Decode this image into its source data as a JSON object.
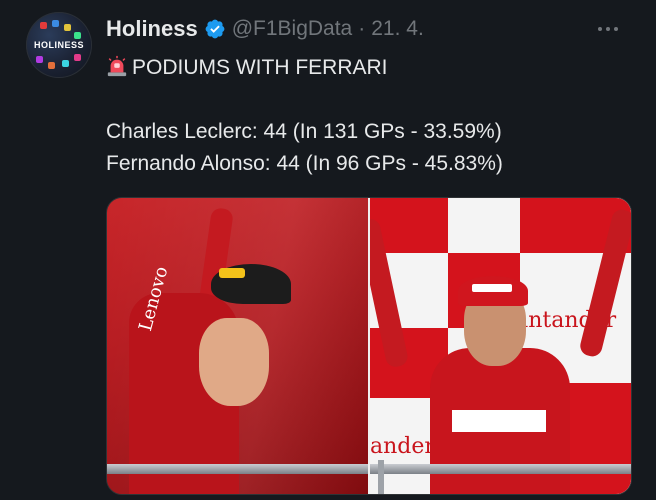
{
  "tweet": {
    "display_name": "Holiness",
    "handle": "@F1BigData",
    "separator": "·",
    "date": "21. 4.",
    "avatar_text": "HOLINESS",
    "lines": [
      "PODIUMS WITH FERRARI",
      "Charles Leclerc: 44 (In 131 GPs - 33.59%)",
      "Fernando Alonso: 44 (In 96 GPs - 45.83%)"
    ]
  },
  "media": {
    "left_sponsor_text": "Lenovo",
    "right_sponsor_text": "Santander",
    "right_bottom_text": "ander"
  },
  "icons": {
    "verified": "verified-badge-icon",
    "siren": "police-siren-emoji",
    "more": "more-dots-icon"
  },
  "colors": {
    "background": "#15191e",
    "text_primary": "#e7e9ea",
    "text_secondary": "#71767b",
    "verified_blue": "#1d9bf0",
    "ferrari_red": "#d4131c"
  }
}
